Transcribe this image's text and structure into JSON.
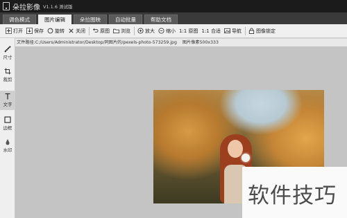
{
  "app": {
    "name": "朵拉影像",
    "version": "V1.1.6 测试版"
  },
  "tabs": [
    {
      "label": "调色模式",
      "active": false
    },
    {
      "label": "图片编辑",
      "active": true
    },
    {
      "label": "朵拉图映",
      "active": false
    },
    {
      "label": "自动批量",
      "active": false
    },
    {
      "label": "帮助文档",
      "active": false
    }
  ],
  "toolbar": {
    "open": "打开",
    "save": "保存",
    "rotate": "旋转",
    "close": "关闭",
    "original": "原图",
    "browse": "浏览",
    "zoom_in": "放大",
    "zoom_out": "缩小",
    "actual_size": "1:1 原图",
    "fit": "1:1 合适",
    "navigate": "导航",
    "lock": "图像锁定"
  },
  "path": {
    "label": "文件路径:",
    "value": "C:/Users/Administrator/Desktop/同图片的/pexels-photo-573259.jpg",
    "size_label": "图片像素500x333"
  },
  "sidebar": [
    {
      "label": "尺寸",
      "icon": "ruler-icon",
      "active": false
    },
    {
      "label": "裁剪",
      "icon": "crop-icon",
      "active": false
    },
    {
      "label": "文字",
      "icon": "text-icon",
      "active": true
    },
    {
      "label": "边框",
      "icon": "frame-icon",
      "active": false
    },
    {
      "label": "水印",
      "icon": "watermark-icon",
      "active": false
    }
  ],
  "overlay_watermark": "软件技巧",
  "colors": {
    "titlebar": "#1b1b1b",
    "tabbar": "#3a3a3a",
    "canvas": "#c4c4c4"
  }
}
